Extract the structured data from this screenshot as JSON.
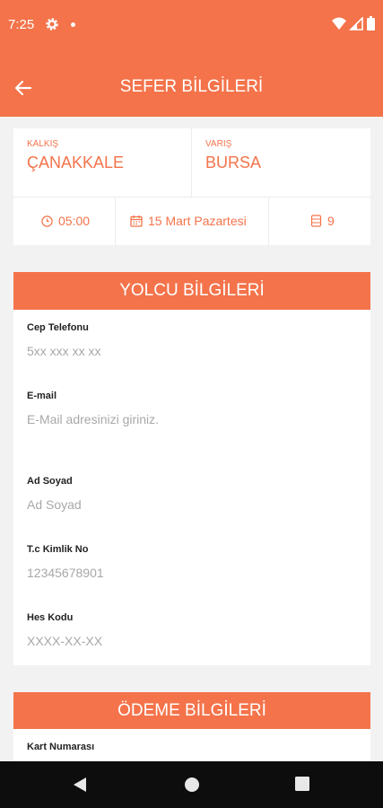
{
  "status_bar": {
    "time": "7:25"
  },
  "app_bar": {
    "title": "SEFER BİLGİLERİ"
  },
  "trip": {
    "from_label": "KALKIŞ",
    "from_city": "ÇANAKKALE",
    "to_label": "VARIŞ",
    "to_city": "BURSA",
    "time": "05:00",
    "date": "15 Mart Pazartesi",
    "seat": "9"
  },
  "passenger": {
    "header": "YOLCU BİLGİLERİ",
    "fields": [
      {
        "label": "Cep Telefonu",
        "placeholder": "5xx xxx xx xx"
      },
      {
        "label": "E-mail",
        "placeholder": "E-Mail adresinizi giriniz."
      },
      {
        "label": "Ad Soyad",
        "placeholder": "Ad Soyad"
      },
      {
        "label": "T.c Kimlik No",
        "placeholder": "12345678901"
      },
      {
        "label": "Hes Kodu",
        "placeholder": "XXXX-XX-XX"
      }
    ]
  },
  "payment": {
    "header": "ÖDEME BİLGİLERİ",
    "card_number_label": "Kart Numarası"
  },
  "colors": {
    "accent": "#f4734a",
    "background": "#f2f2f2",
    "navbar": "#0d0d0d"
  }
}
